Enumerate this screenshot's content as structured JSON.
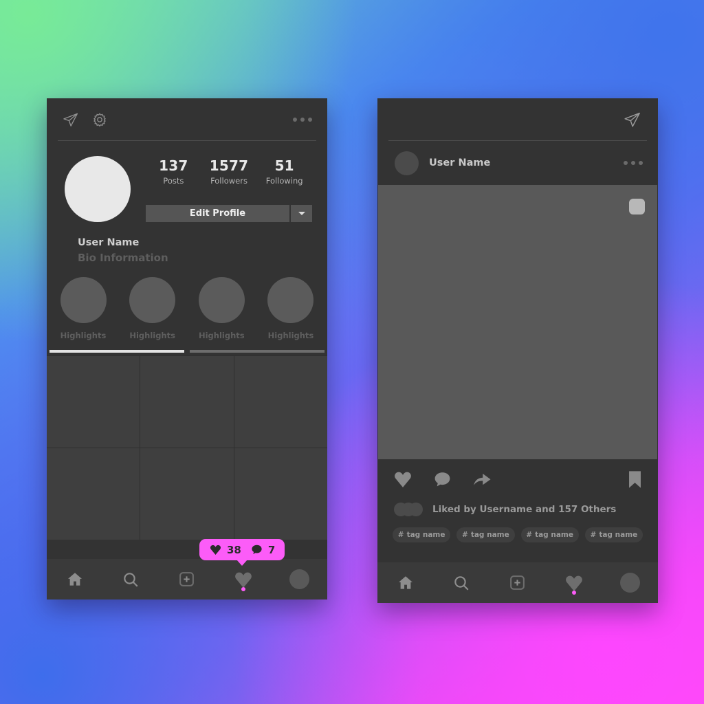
{
  "background": {
    "colors": [
      "#78eb96",
      "#3e73eb",
      "#6a6af5",
      "#9a5cf5",
      "#ff4df0"
    ]
  },
  "theme": {
    "panel": "#333333",
    "surface": "#3f3f3f",
    "accent_pink": "#fc5cf8",
    "text_primary": "#e9e9e9",
    "text_muted": "#5e5e5e"
  },
  "profile_screen": {
    "header": {
      "send_icon": "paper-plane-icon",
      "settings_icon": "gear-icon",
      "overflow_icon": "more-horizontal-icon"
    },
    "avatar": "profile-avatar",
    "stats": [
      {
        "value": "137",
        "label": "Posts"
      },
      {
        "value": "1577",
        "label": "Followers"
      },
      {
        "value": "51",
        "label": "Following"
      }
    ],
    "edit_button": "Edit Profile",
    "edit_dropdown_icon": "chevron-down-icon",
    "username": "User Name",
    "bio": "Bio Information",
    "highlights": [
      {
        "label": "Highlights"
      },
      {
        "label": "Highlights"
      },
      {
        "label": "Highlights"
      },
      {
        "label": "Highlights"
      }
    ],
    "tabs": {
      "active": "grid",
      "inactive": "tagged"
    },
    "grid_cells": 6,
    "badge": {
      "like_icon": "heart-icon",
      "like_count": "38",
      "comment_icon": "comment-icon",
      "comment_count": "7"
    },
    "navbar": [
      {
        "name": "home",
        "icon": "home-icon"
      },
      {
        "name": "search",
        "icon": "search-icon"
      },
      {
        "name": "create",
        "icon": "plus-square-icon"
      },
      {
        "name": "activity",
        "icon": "heart-icon",
        "has_dot": true
      },
      {
        "name": "profile",
        "icon": "avatar-icon"
      }
    ]
  },
  "feed_screen": {
    "header": {
      "send_icon": "paper-plane-icon"
    },
    "post": {
      "avatar": "post-author-avatar",
      "username": "User Name",
      "overflow_icon": "more-horizontal-icon",
      "carousel_indicator": "carousel-icon",
      "actions": {
        "like_icon": "heart-icon",
        "comment_icon": "comment-icon",
        "share_icon": "share-arrow-icon",
        "save_icon": "bookmark-icon"
      },
      "liked_by": "Liked by Username and 157 Others",
      "tags": [
        {
          "hash": "#",
          "label": "tag name"
        },
        {
          "hash": "#",
          "label": "tag name"
        },
        {
          "hash": "#",
          "label": "tag name"
        },
        {
          "hash": "#",
          "label": "tag name"
        }
      ]
    },
    "navbar": [
      {
        "name": "home",
        "icon": "home-icon"
      },
      {
        "name": "search",
        "icon": "search-icon"
      },
      {
        "name": "create",
        "icon": "plus-square-icon"
      },
      {
        "name": "activity",
        "icon": "heart-icon",
        "has_dot": true
      },
      {
        "name": "profile",
        "icon": "avatar-icon"
      }
    ]
  }
}
